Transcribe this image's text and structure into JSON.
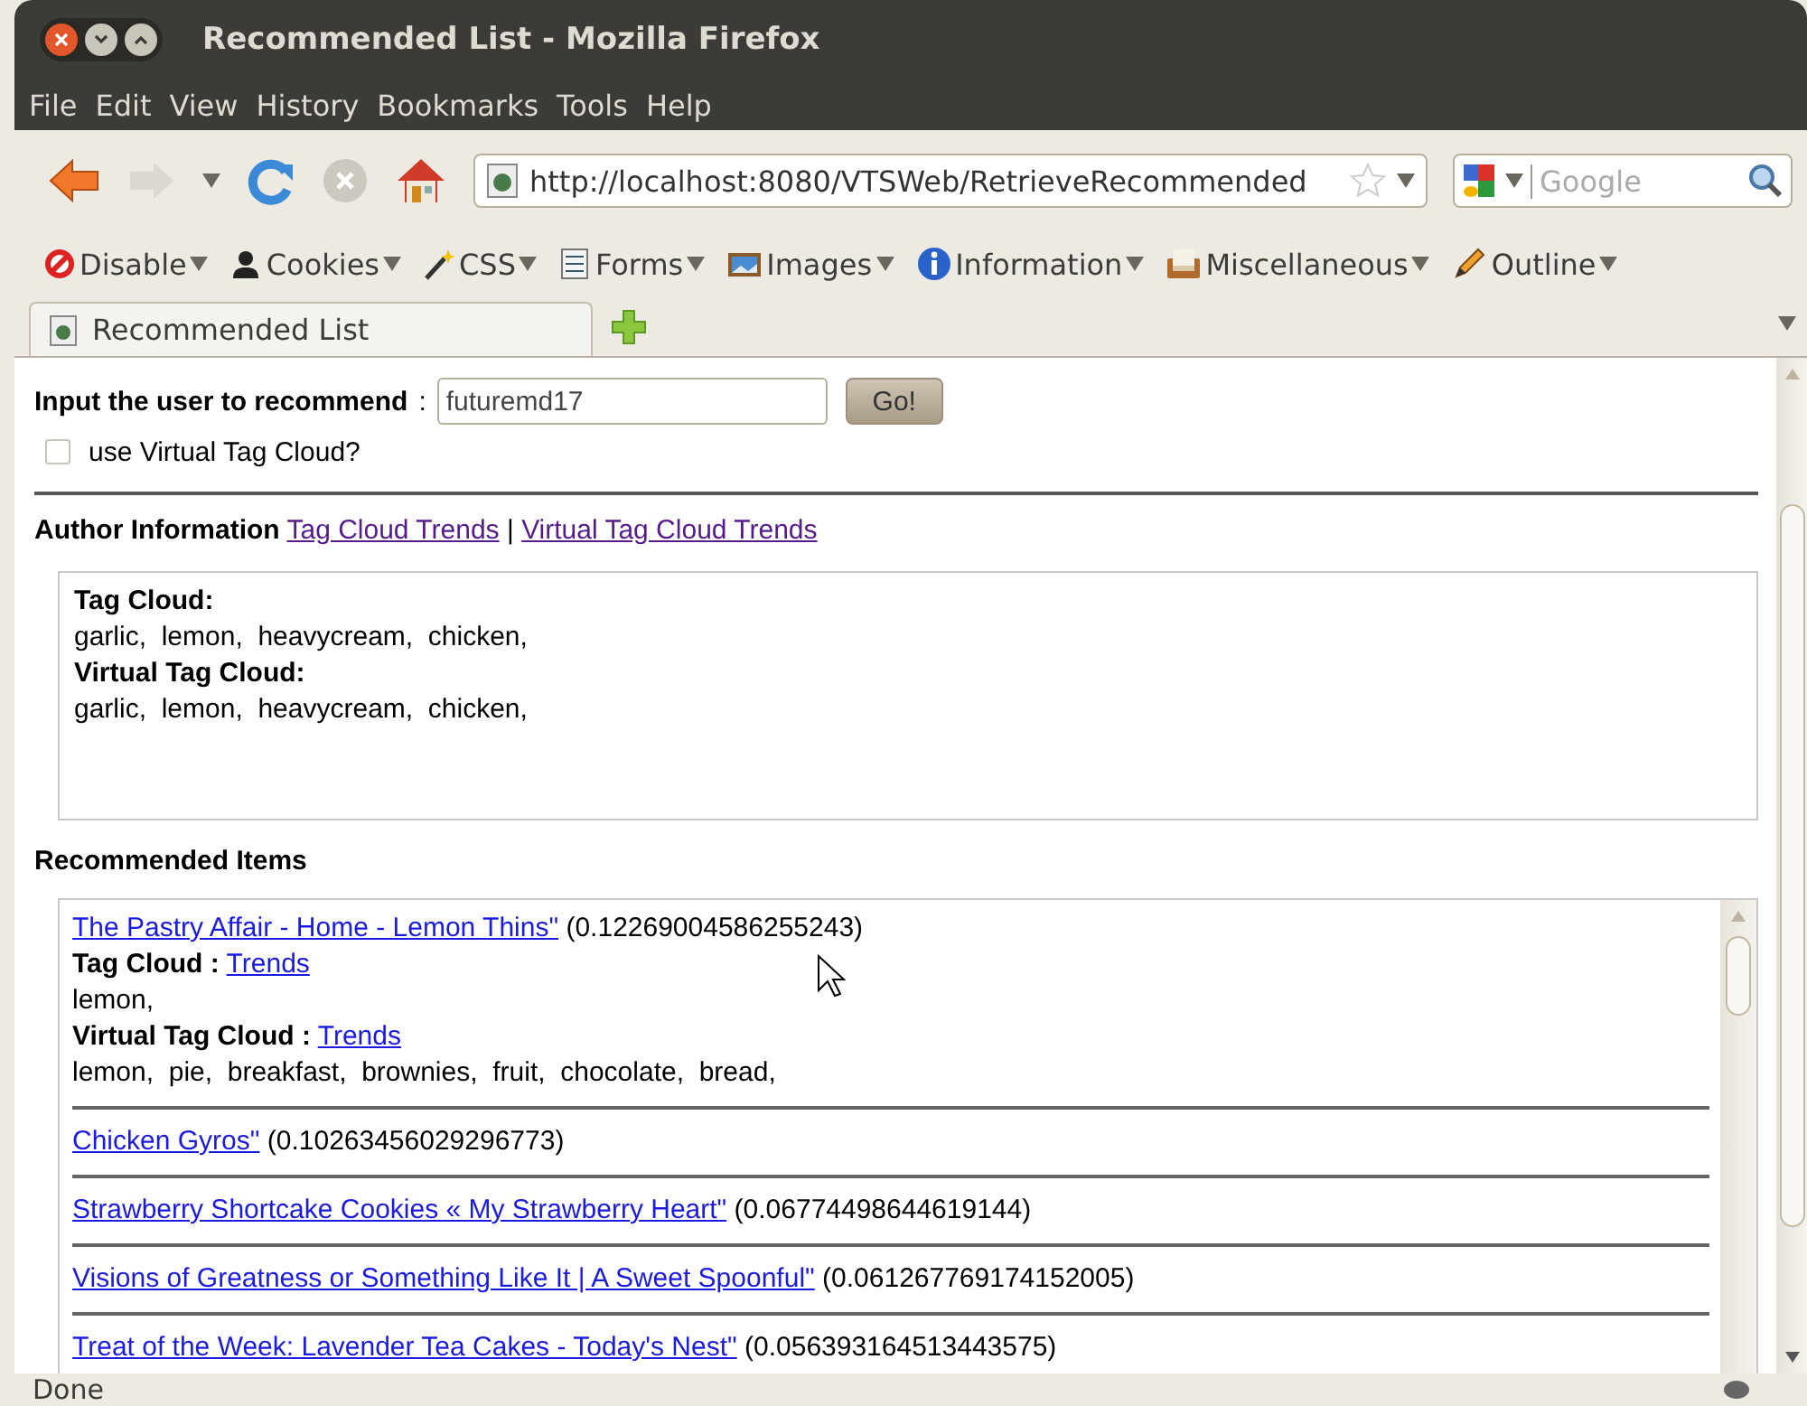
{
  "window": {
    "title": "Recommended List - Mozilla Firefox"
  },
  "menu": [
    "File",
    "Edit",
    "View",
    "History",
    "Bookmarks",
    "Tools",
    "Help"
  ],
  "navigation": {
    "url": "http://localhost:8080/VTSWeb/RetrieveRecommended",
    "search_placeholder": "Google"
  },
  "dev_toolbar": [
    {
      "kind": "disable",
      "label": "Disable"
    },
    {
      "kind": "cookies",
      "label": "Cookies"
    },
    {
      "kind": "css",
      "label": "CSS"
    },
    {
      "kind": "forms",
      "label": "Forms"
    },
    {
      "kind": "images",
      "label": "Images"
    },
    {
      "kind": "information",
      "label": "Information"
    },
    {
      "kind": "misc",
      "label": "Miscellaneous"
    },
    {
      "kind": "outline",
      "label": "Outline"
    }
  ],
  "tabs": [
    {
      "label": "Recommended List",
      "selected": true
    }
  ],
  "form": {
    "label": "Input the user to recommend",
    "separator": ":",
    "value": "futuremd17",
    "button": "Go!",
    "checkbox": {
      "label": "use Virtual Tag Cloud?",
      "checked": false
    }
  },
  "author": {
    "heading": "Author Information",
    "links": [
      "Tag Cloud Trends",
      "Virtual Tag Cloud Trends"
    ],
    "link_separator": "|",
    "sections": [
      {
        "title": "Tag Cloud:",
        "tags": "garlic,  lemon,  heavycream,  chicken,"
      },
      {
        "title": "Virtual Tag Cloud:",
        "tags": "garlic,  lemon,  heavycream,  chicken,"
      }
    ]
  },
  "recommended": {
    "heading": "Recommended Items",
    "items": [
      {
        "title": "The Pastry Affair - Home - Lemon Thins\"",
        "score": "(0.12269004586255243)",
        "sections": [
          {
            "title": "Tag Cloud :",
            "link": "Trends",
            "tags": "lemon,"
          },
          {
            "title": "Virtual Tag Cloud :",
            "link": "Trends",
            "tags": "lemon,  pie,  breakfast,  brownies,  fruit,  chocolate,  bread,"
          }
        ]
      },
      {
        "title": "Chicken Gyros\"",
        "score": "(0.10263456029296773)"
      },
      {
        "title": "Strawberry Shortcake Cookies « My Strawberry Heart\"",
        "score": "(0.06774498644619144)"
      },
      {
        "title": "Visions of Greatness or Something Like It | A Sweet Spoonful\"",
        "score": "(0.061267769174152005)"
      },
      {
        "title": "Treat of the Week: Lavender Tea Cakes - Today's Nest\"",
        "score": "(0.056393164513443575)"
      }
    ]
  },
  "status_bar": {
    "text": "Done"
  }
}
